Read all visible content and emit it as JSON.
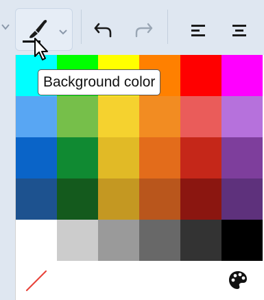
{
  "toolbar": {
    "items": [
      {
        "name": "background-color-button",
        "icon": "paint-brush-icon",
        "active": true,
        "has_dropdown": true
      },
      {
        "name": "undo-button",
        "icon": "undo-icon"
      },
      {
        "name": "redo-button",
        "icon": "redo-icon",
        "disabled": true
      },
      {
        "name": "align-left-button",
        "icon": "align-left-icon"
      },
      {
        "name": "align-center-button",
        "icon": "align-center-icon"
      }
    ],
    "selected_color_indicator": "#000000"
  },
  "tooltip": {
    "text": "Background color"
  },
  "palette": {
    "rows": [
      [
        "#00ffff",
        "#00ff00",
        "#ffff00",
        "#ff8000",
        "#ff0000",
        "#ff00ff"
      ],
      [
        "#58a6f3",
        "#76bf4a",
        "#f5d22f",
        "#f28c22",
        "#ea5c5a",
        "#b671dc"
      ],
      [
        "#0a64c8",
        "#108a32",
        "#e1ba26",
        "#e36c1b",
        "#c52719",
        "#7e3e9c"
      ],
      [
        "#1d528f",
        "#145a1d",
        "#c49822",
        "#b9561c",
        "#8b1610",
        "#5e317c"
      ],
      [
        "#ffffff",
        "#cccccc",
        "#9a9a9a",
        "#686868",
        "#333333",
        "#000000"
      ]
    ],
    "footer": {
      "no_color_icon": "slash-icon",
      "custom_color_icon": "palette-icon",
      "slash_color": "#e8453c"
    }
  }
}
